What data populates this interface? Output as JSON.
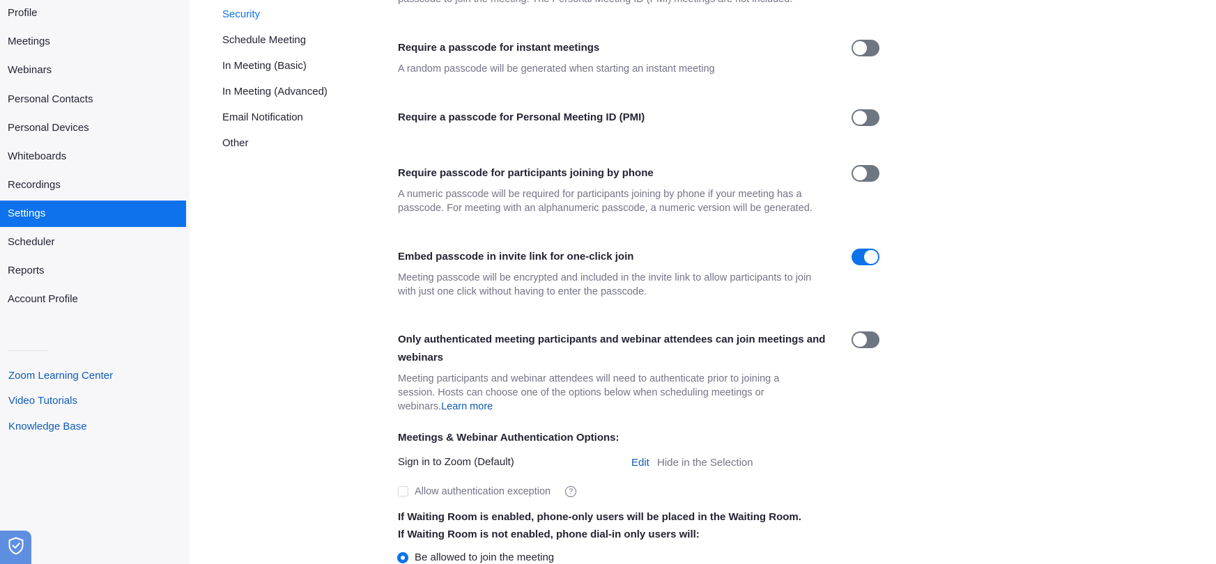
{
  "sidebar": {
    "items": [
      {
        "label": "Profile"
      },
      {
        "label": "Meetings"
      },
      {
        "label": "Webinars"
      },
      {
        "label": "Personal Contacts"
      },
      {
        "label": "Personal Devices"
      },
      {
        "label": "Whiteboards"
      },
      {
        "label": "Recordings"
      },
      {
        "label": "Settings",
        "active": true
      },
      {
        "label": "Scheduler"
      },
      {
        "label": "Reports"
      },
      {
        "label": "Account Profile"
      }
    ],
    "links": [
      {
        "label": "Zoom Learning Center"
      },
      {
        "label": "Video Tutorials"
      },
      {
        "label": "Knowledge Base"
      }
    ],
    "badge_icon": "shield-check-icon"
  },
  "subnav": {
    "items": [
      {
        "label": "Security",
        "active": true
      },
      {
        "label": "Schedule Meeting"
      },
      {
        "label": "In Meeting (Basic)"
      },
      {
        "label": "In Meeting (Advanced)"
      },
      {
        "label": "Email Notification"
      },
      {
        "label": "Other"
      }
    ]
  },
  "settings": {
    "cutoff_text": "passcode to join the meeting. The Personal Meeting ID (PMI) meetings are not included.",
    "instant": {
      "title": "Require a passcode for instant meetings",
      "desc": "A random passcode will be generated when starting an instant meeting",
      "enabled": false
    },
    "pmi": {
      "title": "Require a passcode for Personal Meeting ID (PMI)",
      "enabled": false
    },
    "phone": {
      "title": "Require passcode for participants joining by phone",
      "desc_line1": "A numeric passcode will be required for participants joining by phone if your meeting has a",
      "desc_line2": "passcode. For meeting with an alphanumeric passcode, a numeric version will be generated.",
      "enabled": false
    },
    "embed": {
      "title": "Embed passcode in invite link for one-click join",
      "desc_line1": "Meeting passcode will be encrypted and included in the invite link to allow participants to join",
      "desc_line2": "with just one click without having to enter the passcode.",
      "enabled": true
    },
    "auth": {
      "title_line1": "Only authenticated meeting participants and webinar attendees can join meetings and",
      "title_line2": "webinars",
      "desc_line1": "Meeting participants and webinar attendees will need to authenticate prior to joining a",
      "desc_line2": "session. Hosts can choose one of the options below when scheduling meetings or",
      "desc_line3": "webinars.",
      "learn_more": "Learn more",
      "enabled": false,
      "options_heading": "Meetings & Webinar Authentication Options:",
      "option_name": "Sign in to Zoom (Default)",
      "edit_label": "Edit",
      "hide_label": "Hide in the Selection",
      "exception_label": "Allow authentication exception",
      "exception_checked": false,
      "help_glyph": "?"
    },
    "waiting": {
      "line1": "If Waiting Room is enabled, phone-only users will be placed in the Waiting Room.",
      "line2": "If Waiting Room is not enabled, phone dial-in only users will:",
      "radio_label": "Be allowed to join the meeting",
      "radio_selected": true
    }
  },
  "colors": {
    "accent": "#0e72ed",
    "toggle_off": "#6e7680",
    "link": "#0e5bb5"
  }
}
